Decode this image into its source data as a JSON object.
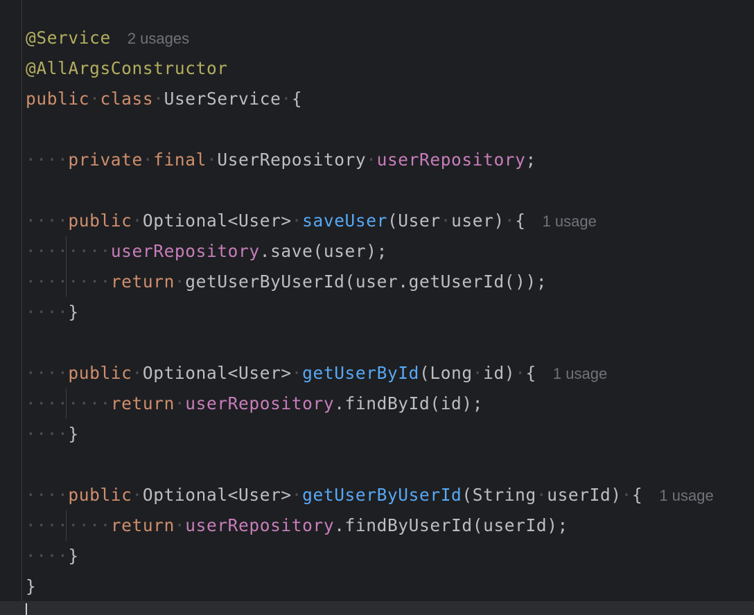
{
  "editor": {
    "language": "Java",
    "lines": [
      {
        "id": "l1",
        "text": "@Service",
        "hint": "2 usages"
      },
      {
        "id": "l2",
        "text": "@AllArgsConstructor"
      },
      {
        "id": "l3",
        "text": "public class UserService {"
      },
      {
        "id": "l4",
        "text": ""
      },
      {
        "id": "l5",
        "text": "    private final UserRepository userRepository;"
      },
      {
        "id": "l6",
        "text": ""
      },
      {
        "id": "l7",
        "text": "    public Optional<User> saveUser(User user) {",
        "hint": "1 usage"
      },
      {
        "id": "l8",
        "text": "        userRepository.save(user);"
      },
      {
        "id": "l9",
        "text": "        return getUserByUserId(user.getUserId());"
      },
      {
        "id": "l10",
        "text": "    }"
      },
      {
        "id": "l11",
        "text": ""
      },
      {
        "id": "l12",
        "text": "    public Optional<User> getUserById(Long id) {",
        "hint": "1 usage"
      },
      {
        "id": "l13",
        "text": "        return userRepository.findById(id);"
      },
      {
        "id": "l14",
        "text": "    }"
      },
      {
        "id": "l15",
        "text": ""
      },
      {
        "id": "l16",
        "text": "    public Optional<User> getUserByUserId(String userId) {",
        "hint": "1 usage"
      },
      {
        "id": "l17",
        "text": "        return userRepository.findByUserId(userId);"
      },
      {
        "id": "l18",
        "text": "    }"
      },
      {
        "id": "l19",
        "text": "}"
      }
    ],
    "colors": {
      "background": "#1e1f22",
      "annotation": "#b3ae60",
      "keyword": "#cf8e6d",
      "field": "#c77dbb",
      "method_declaration": "#56a8f5",
      "default_text": "#bcbec4",
      "inlay_hint": "#6f737a",
      "whitespace_marker": "#4b4d52"
    }
  },
  "tokens": {
    "at_service": "@Service",
    "at_allargs": "@AllArgsConstructor",
    "public": "public",
    "class": "class",
    "private": "private",
    "final": "final",
    "return": "return",
    "user_service": "UserService",
    "open_brace": "{",
    "close_brace": "}",
    "user_repository_type": "UserRepository",
    "user_repository_field": "userRepository",
    "semicolon": ";",
    "optional_user": "Optional<User>",
    "save_user": "saveUser",
    "save_user_params_a": "(User",
    "save_user_params_b": "user)",
    "save_call": ".save(user);",
    "get_user_by_user_id_call": "getUserByUserId(user.getUserId());",
    "get_user_by_id": "getUserById",
    "get_user_by_id_params_a": "(Long",
    "get_user_by_id_params_b": "id)",
    "find_by_id_call": ".findById(id);",
    "get_user_by_user_id": "getUserByUserId",
    "get_user_by_user_id_params_a": "(String",
    "get_user_by_user_id_params_b": "userId)",
    "find_by_user_id_call": ".findByUserId(userId);"
  }
}
